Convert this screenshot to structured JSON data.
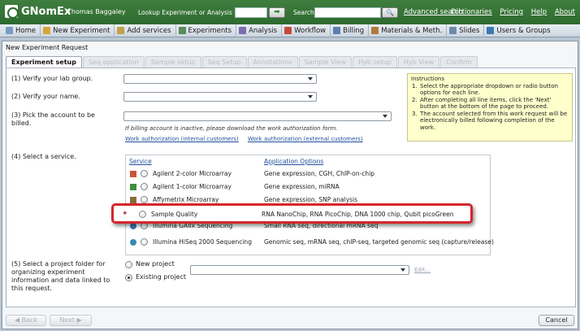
{
  "header": {
    "app_title": "GNomEx",
    "user": "Thomas Baggaley",
    "lookup_label": "Lookup Experiment or Analysis by #",
    "lookup_go": "➡",
    "search_label": "Search",
    "search_button": "🔍",
    "advanced_search": "Advanced search",
    "links": [
      "Dictionaries",
      "Pricing",
      "Help",
      "About"
    ]
  },
  "nav": [
    {
      "label": "Home",
      "color": "#7a9cc4"
    },
    {
      "label": "New Experiment",
      "color": "#d9a43a"
    },
    {
      "label": "Add services",
      "color": "#c4a14a"
    },
    {
      "label": "Experiments",
      "color": "#5a8a5a"
    },
    {
      "label": "Analysis",
      "color": "#7c6bb0"
    },
    {
      "label": "Workflow",
      "color": "#c24b3a"
    },
    {
      "label": "Billing",
      "color": "#5a7fb0"
    },
    {
      "label": "Materials & Meth.",
      "color": "#b07a3a"
    },
    {
      "label": "Slides",
      "color": "#6f8aa8"
    },
    {
      "label": "Users & Groups",
      "color": "#3a7ab0"
    }
  ],
  "panel": {
    "title": "New Experiment Request",
    "tabs": [
      {
        "label": "Experiment setup",
        "active": true
      },
      {
        "label": "Seq application",
        "active": false
      },
      {
        "label": "Sample setup",
        "active": false
      },
      {
        "label": "Seq Setup",
        "active": false
      },
      {
        "label": "Annotations",
        "active": false
      },
      {
        "label": "Sample View",
        "active": false
      },
      {
        "label": "Hyb setup",
        "active": false
      },
      {
        "label": "Hyb View",
        "active": false
      },
      {
        "label": "Confirm",
        "active": false
      }
    ]
  },
  "form": {
    "q1": "(1) Verify your lab group.",
    "q2": "(2) Verify your name.",
    "q3": "(3) Pick the account to be billed.",
    "billing_note": "If billing account is inactive, please download the work authorization form.",
    "work_auth_internal": "Work authorization (internal customers)",
    "work_auth_external": "Work authorization (external customers)",
    "q4": "(4) Select a service.",
    "q5": "(5) Select a project folder for organizing experiment information and data linked to this request.",
    "new_project": "New project",
    "existing_project": "Existing project",
    "edit_link": "Edit..."
  },
  "instructions": {
    "title": "Instructions",
    "items": [
      "Select the appropriate dropdown or radio button options for each line.",
      "After completing all line items, click the 'Next' button at the bottom of the page to proceed.",
      "The account selected from this work request will be electronically billed following completion of the work."
    ]
  },
  "services": {
    "col_service": "Service",
    "col_app": "Application Options",
    "rows": [
      {
        "name": "Agilent 2-color Microarray",
        "apps": "Gene expression, CGH, ChIP-on-chip",
        "icon_color": "#c9553a"
      },
      {
        "name": "Agilent 1-color Microarray",
        "apps": "Gene expression, miRNA",
        "icon_color": "#3f8f3f"
      },
      {
        "name": "Affymetrix Microarray",
        "apps": "Gene expression, SNP analysis",
        "icon_color": "#8a6d3b"
      },
      {
        "name": "Sample Quality",
        "apps": "RNA NanoChip, RNA PicoChip, DNA 1000 chip, Qubit picoGreen",
        "icon_color": "#b03a5a"
      },
      {
        "name": "Illumina GAIIx Sequencing",
        "apps": "Small RNA seq, directional mRNA seq",
        "icon_color": "#3a7ab0"
      },
      {
        "name": "Illumina HiSeq 2000 Sequencing",
        "apps": "Genomic seq, mRNA seq, chIP-seq, targeted genomic seq (capture/release)",
        "icon_color": "#3a8ab0"
      }
    ]
  },
  "buttons": {
    "back": "◀ Back",
    "next": "Next ▶",
    "cancel": "Cancel"
  }
}
